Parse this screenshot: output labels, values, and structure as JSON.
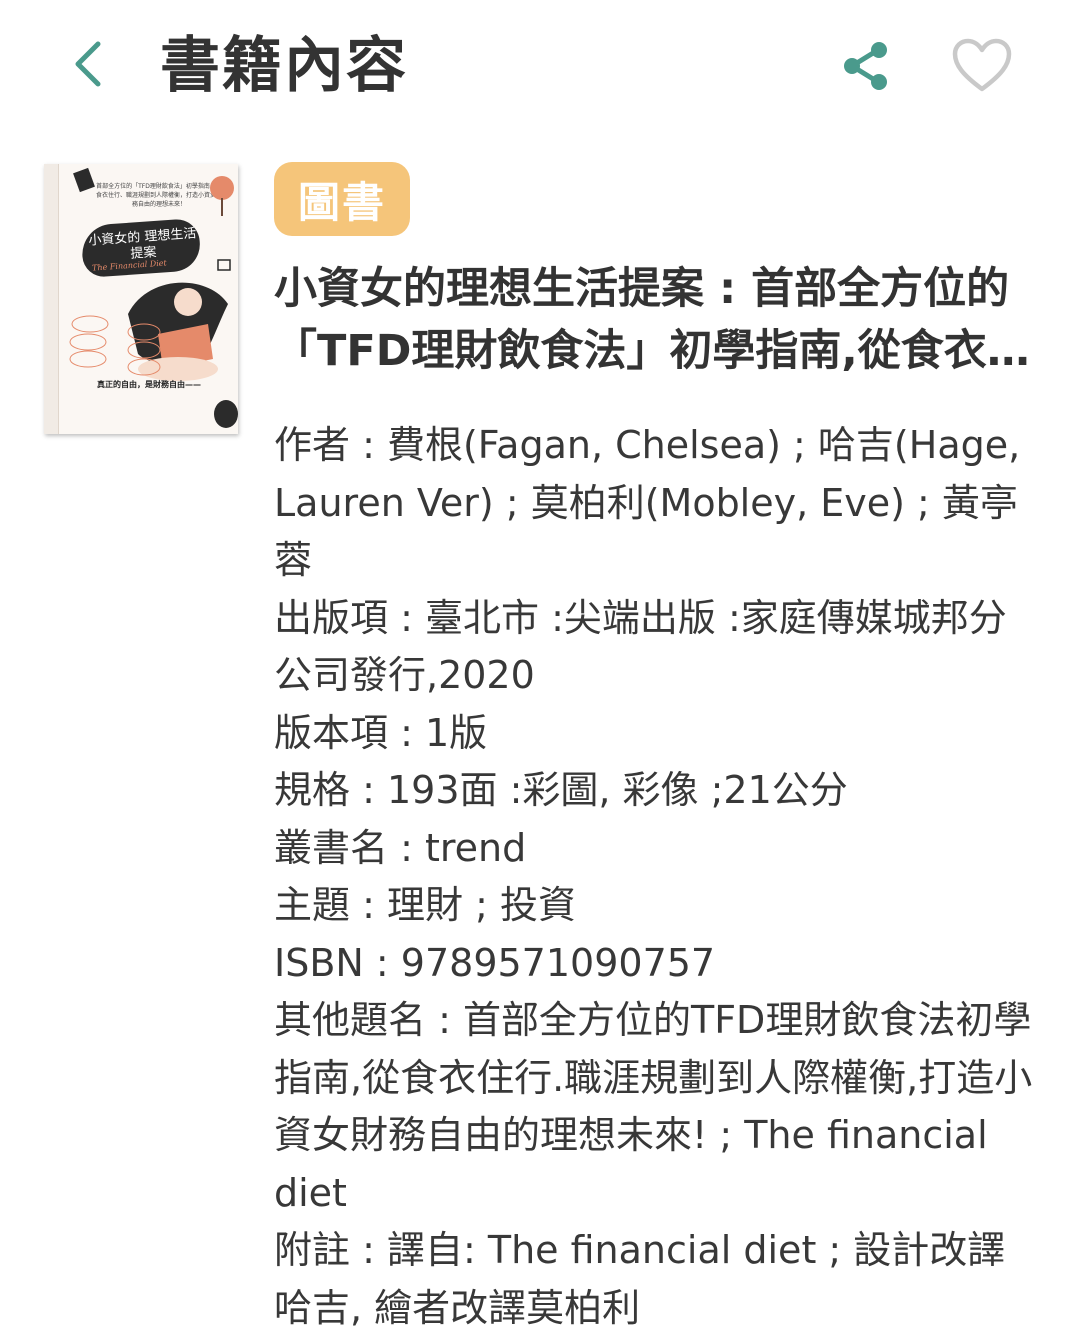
{
  "header": {
    "title": "書籍內容",
    "back_icon": "chevron-left-icon",
    "share_icon": "share-icon",
    "favorite_icon": "heart-outline-icon",
    "accent_color": "#4a9a8c"
  },
  "book": {
    "category_badge": "圖書",
    "badge_color": "#f5c57a",
    "title": "小資女的理想生活提案 : 首部全方位的「TFD理財飲食法」初學指南,從食衣住行.職涯規劃到人際權衡,打造小資女財務自由的理想未來!",
    "cover": {
      "top_text": "首部全方位的「TFD理財飲食法」初學指南，從食衣住行、職涯規劃到人際權衡，打造小資女財務自由的理想未來！",
      "main_title": "小資女的 理想生活提案",
      "subtitle": "The Financial Diet",
      "lower_text": "真正的自由，是財務自由——"
    },
    "details": [
      {
        "label": "作者",
        "value": "費根(Fagan, Chelsea) ; 哈吉(Hage, Lauren Ver) ; 莫柏利(Mobley, Eve) ; 黃亭蓉"
      },
      {
        "label": "出版項",
        "value": "臺北市 :尖端出版 :家庭傳媒城邦分公司發行,2020"
      },
      {
        "label": "版本項",
        "value": "1版"
      },
      {
        "label": "規格",
        "value": "193面 :彩圖, 彩像 ;21公分"
      },
      {
        "label": "叢書名",
        "value": "trend"
      },
      {
        "label": "主題",
        "value": "理財 ; 投資"
      },
      {
        "label": "ISBN",
        "value": "9789571090757"
      },
      {
        "label": "其他題名",
        "value": "首部全方位的TFD理財飲食法初學指南,從食衣住行.職涯規劃到人際權衡,打造小資女財務自由的理想未來! ; The financial diet"
      },
      {
        "label": "附註",
        "value": "譯自: The financial diet ; 設計改譯哈吉, 繪者改譯莫柏利"
      }
    ],
    "separator": " : "
  }
}
